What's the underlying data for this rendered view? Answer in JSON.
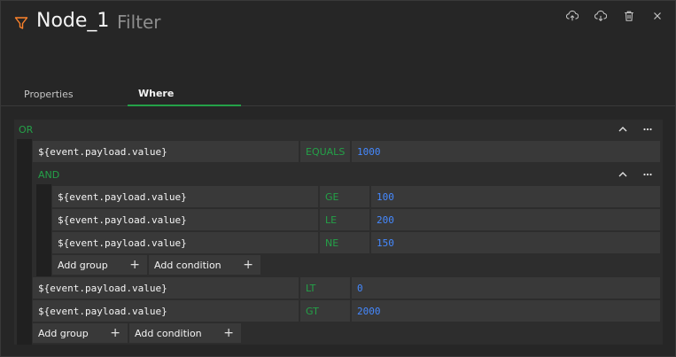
{
  "header": {
    "title": "Node_1",
    "subtitle": "Filter",
    "icons": [
      "filter-icon",
      "upload-icon",
      "download-icon",
      "trash-icon",
      "close-icon"
    ]
  },
  "tabs": [
    {
      "label": "Properties",
      "active": false
    },
    {
      "label": "Where",
      "active": true
    }
  ],
  "builder": {
    "root_operator": "OR",
    "root_conditions_before": [
      {
        "field": "${event.payload.value}",
        "operator": "EQUALS",
        "value": "1000"
      }
    ],
    "nested": {
      "operator": "AND",
      "conditions": [
        {
          "field": "${event.payload.value}",
          "operator": "GE",
          "value": "100"
        },
        {
          "field": "${event.payload.value}",
          "operator": "LE",
          "value": "200"
        },
        {
          "field": "${event.payload.value}",
          "operator": "NE",
          "value": "150"
        }
      ],
      "add_group": "Add group",
      "add_condition": "Add condition"
    },
    "root_conditions_after": [
      {
        "field": "${event.payload.value}",
        "operator": "LT",
        "value": "0"
      },
      {
        "field": "${event.payload.value}",
        "operator": "GT",
        "value": "2000"
      }
    ],
    "add_group": "Add group",
    "add_condition": "Add condition"
  },
  "colors": {
    "accent_green": "#24a148",
    "value_blue": "#4589ff",
    "filter_icon": "#ff832b"
  }
}
